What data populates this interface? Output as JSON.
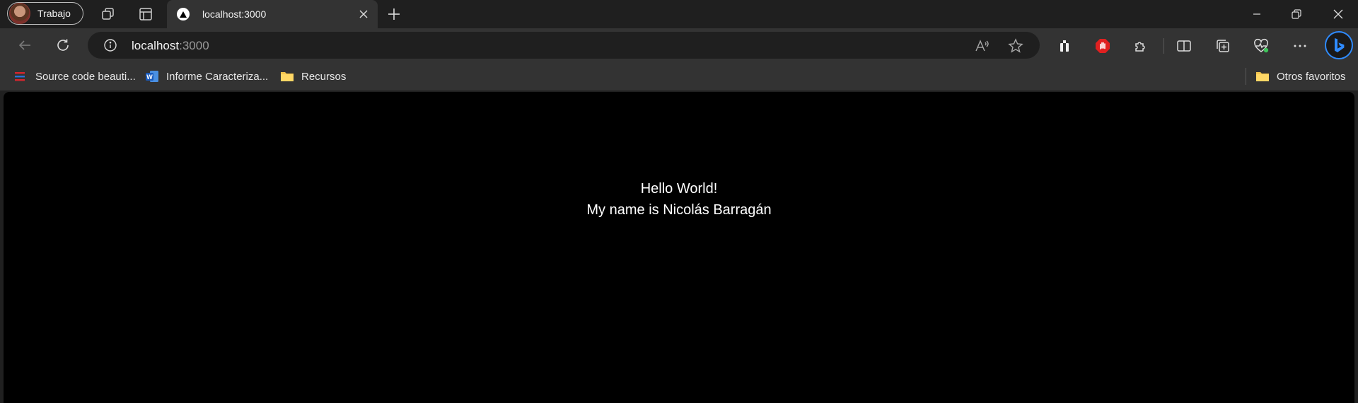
{
  "browser": {
    "profile_label": "Trabajo",
    "tab": {
      "title": "localhost:3000"
    },
    "address": {
      "host": "localhost",
      "port": ":3000"
    }
  },
  "favorites": {
    "items": [
      {
        "label": "Source code beauti..."
      },
      {
        "label": "Informe Caracteriza..."
      },
      {
        "label": "Recursos"
      }
    ],
    "other_label": "Otros favoritos"
  },
  "page": {
    "line1": "Hello World!",
    "line2": "My name is Nicolás Barragán"
  },
  "colors": {
    "accent_blue": "#2f8bff",
    "folder_yellow": "#f4c64f",
    "stop_red": "#e02020"
  }
}
